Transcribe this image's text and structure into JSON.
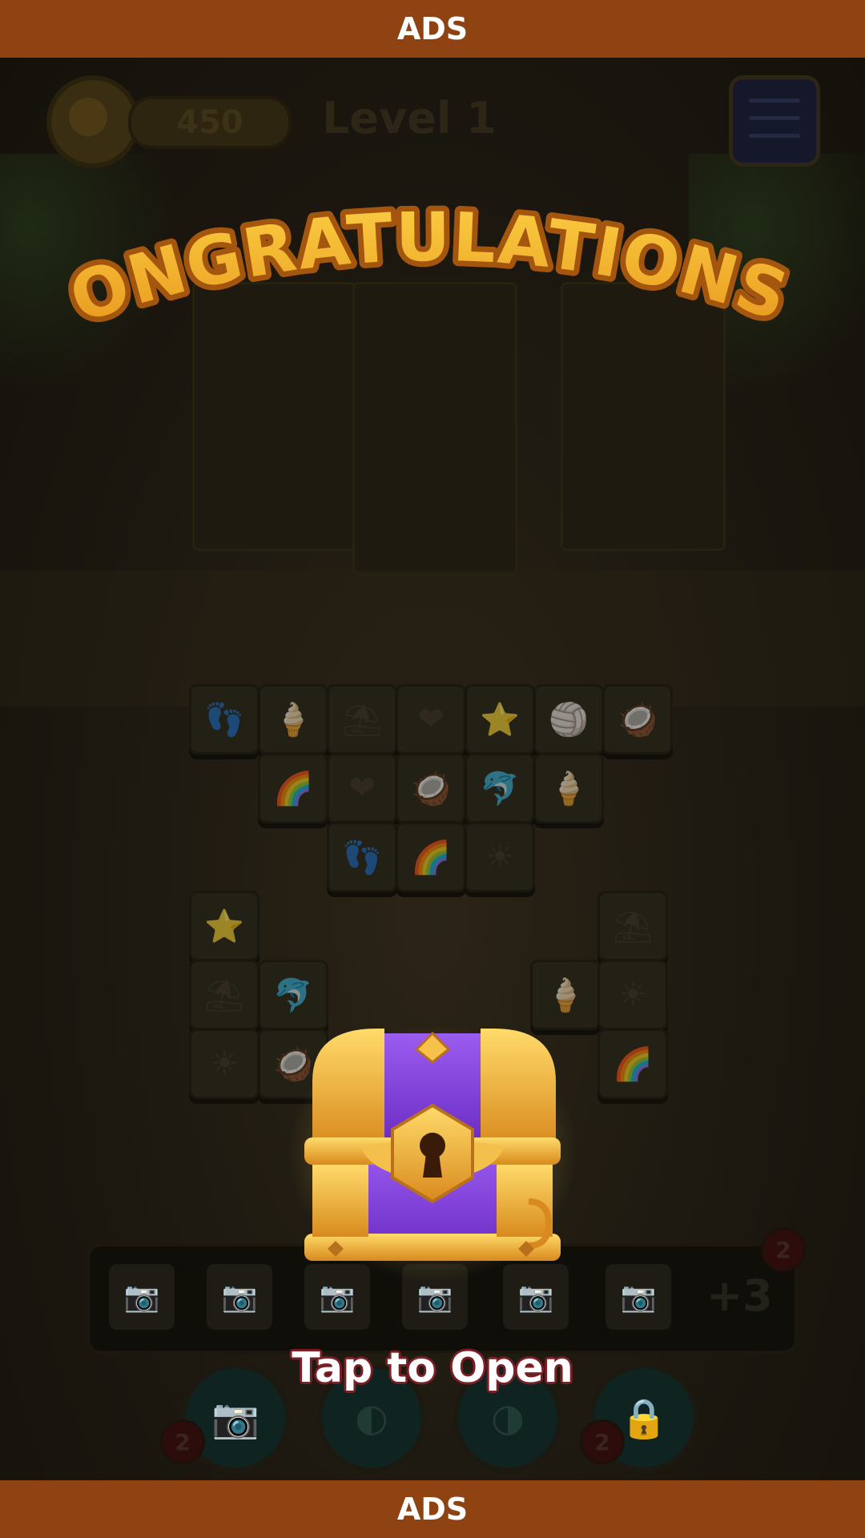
{
  "ads": {
    "top_label": "ADS",
    "bottom_label": "ADS"
  },
  "hud": {
    "score": "450",
    "level": "Level 1",
    "settings_icon": "settings-sliders-icon",
    "coin_icon": "coin-icon"
  },
  "overlay": {
    "title": "CONGRATULATIONS !",
    "reward_icon": "treasure-chest-icon",
    "cta": "Tap to Open"
  },
  "board": {
    "rows": [
      [
        "👣",
        "🍦",
        "⛱",
        "❤",
        "⭐",
        "🏐",
        "🥥"
      ],
      [
        "🌈",
        "❤",
        "🥥",
        "🐬",
        "🍦"
      ],
      [
        "👣",
        "🌈",
        "☀"
      ]
    ],
    "left_stack": [
      "⭐",
      "⛱",
      "🐬",
      "☀",
      "🥥"
    ],
    "right_stack": [
      "⛱",
      "🍦",
      "☀",
      "🌈"
    ]
  },
  "tray": {
    "slots": [
      "📷",
      "📷",
      "📷",
      "📷",
      "📷",
      "📷"
    ],
    "more": "+3",
    "badge": "2"
  },
  "boosters": [
    {
      "icon": "📷",
      "badge": "2"
    },
    {
      "icon": "◐",
      "badge": ""
    },
    {
      "icon": "◑",
      "badge": ""
    },
    {
      "icon": "🔒",
      "badge": "2"
    }
  ],
  "colors": {
    "ads_bar": "#8f4312",
    "title_gold": "#f7c23a",
    "chest_purple": "#7b3bd6",
    "chest_gold": "#e9a331"
  }
}
